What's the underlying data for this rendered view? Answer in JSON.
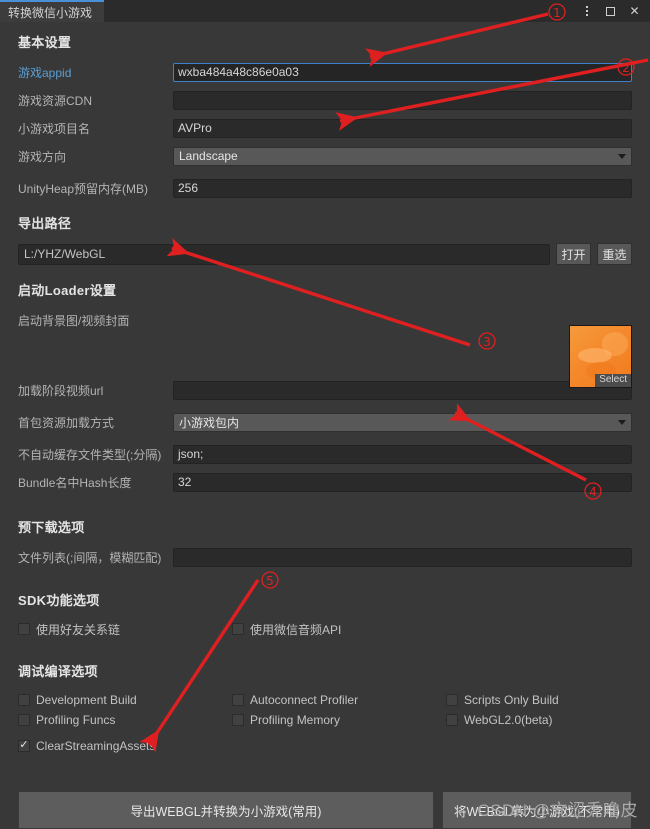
{
  "window": {
    "tab_title": "转换微信小游戏",
    "menu_icon": "kebab-menu-icon",
    "maximize_icon": "maximize-icon",
    "close_icon": "close-icon"
  },
  "sections": {
    "basic": {
      "title": "基本设置",
      "fields": [
        {
          "label": "游戏appid",
          "value": "wxba484a48c86e0a03",
          "type": "text",
          "focused": true,
          "link_label": true
        },
        {
          "label": "游戏资源CDN",
          "value": "",
          "type": "text",
          "focused": false,
          "link_label": false
        },
        {
          "label": "小游戏项目名",
          "value": "AVPro",
          "type": "text",
          "focused": false,
          "link_label": false
        },
        {
          "label": "游戏方向",
          "value": "Landscape",
          "type": "dropdown",
          "focused": false,
          "link_label": false
        },
        {
          "label": "UnityHeap预留内存(MB)",
          "value": "256",
          "type": "text",
          "focused": false,
          "link_label": false
        }
      ]
    },
    "export": {
      "title": "导出路径",
      "path_value": "L:/YHZ/WebGL",
      "open_button": "打开",
      "reselect_button": "重选"
    },
    "loader": {
      "title": "启动Loader设置",
      "cover_label": "启动背景图/视频封面",
      "thumbnail_select_label": "Select",
      "fields": [
        {
          "label": "加载阶段视频url",
          "value": "",
          "type": "text"
        },
        {
          "label": "首包资源加载方式",
          "value": "小游戏包内",
          "type": "dropdown"
        },
        {
          "label": "不自动缓存文件类型(;分隔)",
          "value": "json;",
          "type": "text"
        },
        {
          "label": "Bundle名中Hash长度",
          "value": "32",
          "type": "text"
        }
      ]
    },
    "predownload": {
      "title": "预下载选项",
      "fields": [
        {
          "label": "文件列表(;间隔，模糊匹配)",
          "value": "",
          "type": "text"
        }
      ]
    },
    "sdk": {
      "title": "SDK功能选项",
      "checkboxes": [
        {
          "label": "使用好友关系链",
          "checked": false
        },
        {
          "label": "使用微信音频API",
          "checked": false
        }
      ]
    },
    "debug": {
      "title": "调试编译选项",
      "checkboxes": [
        {
          "label": "Development Build",
          "checked": false
        },
        {
          "label": "Autoconnect Profiler",
          "checked": false
        },
        {
          "label": "Scripts Only Build",
          "checked": false
        },
        {
          "label": "Profiling Funcs",
          "checked": false
        },
        {
          "label": "Profiling Memory",
          "checked": false
        },
        {
          "label": "WebGL2.0(beta)",
          "checked": false
        },
        {
          "label": "ClearStreamingAssets",
          "checked": true
        }
      ]
    }
  },
  "actions": {
    "primary_button": "导出WEBGL并转换为小游戏(常用)",
    "secondary_button": "将WEBGL转为小游戏(不常用)"
  },
  "annotations": {
    "accent_color": "#e02020",
    "markers": [
      {
        "id": "1",
        "glyph": "①"
      },
      {
        "id": "2",
        "glyph": "②"
      },
      {
        "id": "3",
        "glyph": "③"
      },
      {
        "id": "4",
        "glyph": "④"
      },
      {
        "id": "5",
        "glyph": "⑤"
      }
    ]
  },
  "watermark": "CSDN @亢涩秃噜皮"
}
